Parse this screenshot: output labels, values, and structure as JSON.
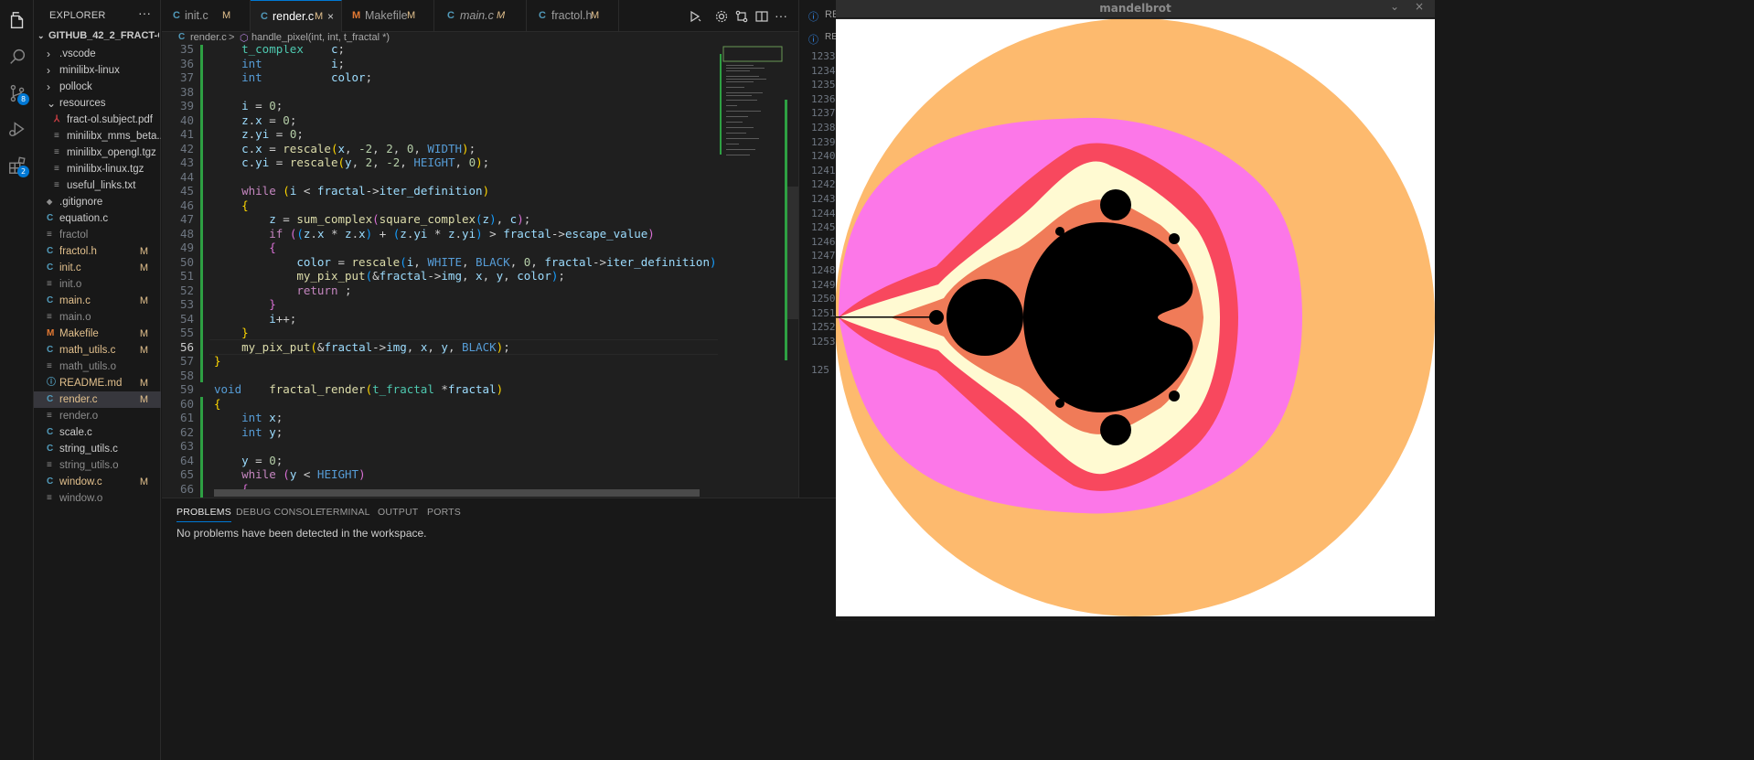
{
  "activity": {
    "scm_badge": "8",
    "ext_badge": "2"
  },
  "explorer": {
    "header": "EXPLORER",
    "more": "···",
    "root": "GITHUB_42_2_FRACT-OL",
    "items": [
      {
        "label": ".vscode",
        "type": "folder",
        "mark": ""
      },
      {
        "label": "minilibx-linux",
        "type": "folder",
        "mark": ""
      },
      {
        "label": "pollock",
        "type": "folder",
        "mark": ""
      },
      {
        "label": "resources",
        "type": "folder-open",
        "mark": ""
      },
      {
        "label": "fract-ol.subject.pdf",
        "type": "pdf",
        "mark": ""
      },
      {
        "label": "minilibx_mms_beta...",
        "type": "file",
        "mark": ""
      },
      {
        "label": "minilibx_opengl.tgz",
        "type": "file",
        "mark": ""
      },
      {
        "label": "minilibx-linux.tgz",
        "type": "file",
        "mark": ""
      },
      {
        "label": "useful_links.txt",
        "type": "file",
        "mark": ""
      },
      {
        "label": ".gitignore",
        "type": "git",
        "mark": ""
      },
      {
        "label": "equation.c",
        "type": "c",
        "mark": ""
      },
      {
        "label": "fractol",
        "type": "file",
        "mark": ""
      },
      {
        "label": "fractol.h",
        "type": "c",
        "mark": "M"
      },
      {
        "label": "init.c",
        "type": "c",
        "mark": "M"
      },
      {
        "label": "init.o",
        "type": "file",
        "mark": ""
      },
      {
        "label": "main.c",
        "type": "c",
        "mark": "M"
      },
      {
        "label": "main.o",
        "type": "file",
        "mark": ""
      },
      {
        "label": "Makefile",
        "type": "make",
        "mark": "M"
      },
      {
        "label": "math_utils.c",
        "type": "c",
        "mark": "M"
      },
      {
        "label": "math_utils.o",
        "type": "file",
        "mark": ""
      },
      {
        "label": "README.md",
        "type": "md",
        "mark": "M"
      },
      {
        "label": "render.c",
        "type": "c",
        "mark": "M"
      },
      {
        "label": "render.o",
        "type": "file",
        "mark": ""
      },
      {
        "label": "scale.c",
        "type": "c",
        "mark": ""
      },
      {
        "label": "string_utils.c",
        "type": "c",
        "mark": ""
      },
      {
        "label": "string_utils.o",
        "type": "file",
        "mark": ""
      },
      {
        "label": "window.c",
        "type": "c",
        "mark": "M"
      },
      {
        "label": "window.o",
        "type": "file",
        "mark": ""
      }
    ]
  },
  "tabs": [
    {
      "icon": "C",
      "label": "init.c",
      "mark": "M"
    },
    {
      "icon": "C",
      "label": "render.c",
      "mark": "M",
      "close": "×"
    },
    {
      "icon": "M",
      "label": "Makefile",
      "mark": "M"
    },
    {
      "icon": "C",
      "label": "main.c",
      "mark": "M"
    },
    {
      "icon": "C",
      "label": "fractol.h",
      "mark": "M"
    }
  ],
  "right_tab": {
    "icon": "ⓘ",
    "label": "RE"
  },
  "breadcrumb": {
    "file": "render.c",
    "sep": ">",
    "symbol": "handle_pixel(int, int, t_fractal *)"
  },
  "code": {
    "current_line": "56",
    "lines": [
      {
        "n": "35",
        "html": "    <span class='k-typ2'>t_complex</span>    <span class='k-var'>c</span>;"
      },
      {
        "n": "36",
        "html": "    <span class='k-type'>int</span>          <span class='k-var'>i</span>;"
      },
      {
        "n": "37",
        "html": "    <span class='k-type'>int</span>          <span class='k-var'>color</span>;"
      },
      {
        "n": "38",
        "html": ""
      },
      {
        "n": "39",
        "html": "    <span class='k-var'>i</span> = <span class='k-num'>0</span>;"
      },
      {
        "n": "40",
        "html": "    <span class='k-var'>z</span>.<span class='k-var'>x</span> = <span class='k-num'>0</span>;"
      },
      {
        "n": "41",
        "html": "    <span class='k-var'>z</span>.<span class='k-var'>yi</span> = <span class='k-num'>0</span>;"
      },
      {
        "n": "42",
        "html": "    <span class='k-var'>c</span>.<span class='k-var'>x</span> = <span class='k-fn'>rescale</span><span class='k-br'>(</span><span class='k-var'>x</span>, <span class='k-num'>-2</span>, <span class='k-num'>2</span>, <span class='k-num'>0</span>, <span class='k-mac'>WIDTH</span><span class='k-br'>)</span>;"
      },
      {
        "n": "43",
        "html": "    <span class='k-var'>c</span>.<span class='k-var'>yi</span> = <span class='k-fn'>rescale</span><span class='k-br'>(</span><span class='k-var'>y</span>, <span class='k-num'>2</span>, <span class='k-num'>-2</span>, <span class='k-mac'>HEIGHT</span>, <span class='k-num'>0</span><span class='k-br'>)</span>;"
      },
      {
        "n": "44",
        "html": ""
      },
      {
        "n": "45",
        "html": "    <span class='k-ctl'>while</span> <span class='k-br'>(</span><span class='k-var'>i</span> &lt; <span class='k-var'>fractal</span>-&gt;<span class='k-var'>iter_definition</span><span class='k-br'>)</span>"
      },
      {
        "n": "46",
        "html": "    <span class='k-br'>{</span>"
      },
      {
        "n": "47",
        "html": "        <span class='k-var'>z</span> = <span class='k-fn'>sum_complex</span><span class='k-br2'>(</span><span class='k-fn'>square_complex</span><span class='k-br3'>(</span><span class='k-var'>z</span><span class='k-br3'>)</span>, <span class='k-var'>c</span><span class='k-br2'>)</span>;"
      },
      {
        "n": "48",
        "html": "        <span class='k-ctl'>if</span> <span class='k-br2'>(</span><span class='k-br3'>(</span><span class='k-var'>z</span>.<span class='k-var'>x</span> * <span class='k-var'>z</span>.<span class='k-var'>x</span><span class='k-br3'>)</span> + <span class='k-br3'>(</span><span class='k-var'>z</span>.<span class='k-var'>yi</span> * <span class='k-var'>z</span>.<span class='k-var'>yi</span><span class='k-br3'>)</span> &gt; <span class='k-var'>fractal</span>-&gt;<span class='k-var'>escape_value</span><span class='k-br2'>)</span>"
      },
      {
        "n": "49",
        "html": "        <span class='k-br2'>{</span>"
      },
      {
        "n": "50",
        "html": "            <span class='k-var'>color</span> = <span class='k-fn'>rescale</span><span class='k-br3'>(</span><span class='k-var'>i</span>, <span class='k-mac'>WHITE</span>, <span class='k-mac'>BLACK</span>, <span class='k-num'>0</span>, <span class='k-var'>fractal</span>-&gt;<span class='k-var'>iter_definition</span><span class='k-br3'>)</span>;"
      },
      {
        "n": "51",
        "html": "            <span class='k-fn'>my_pix_put</span><span class='k-br3'>(</span>&amp;<span class='k-var'>fractal</span>-&gt;<span class='k-var'>img</span>, <span class='k-var'>x</span>, <span class='k-var'>y</span>, <span class='k-var'>color</span><span class='k-br3'>)</span>;"
      },
      {
        "n": "52",
        "html": "            <span class='k-ctl'>return</span> ;"
      },
      {
        "n": "53",
        "html": "        <span class='k-br2'>}</span>"
      },
      {
        "n": "54",
        "html": "        <span class='k-var'>i</span>++;"
      },
      {
        "n": "55",
        "html": "    <span class='k-br'>}</span>"
      },
      {
        "n": "56",
        "html": "    <span class='k-fn'>my_pix_put</span><span class='k-br'>(</span>&amp;<span class='k-var'>fractal</span>-&gt;<span class='k-var'>img</span>, <span class='k-var'>x</span>, <span class='k-var'>y</span>, <span class='k-mac'>BLACK</span><span class='k-br'>)</span>;"
      },
      {
        "n": "57",
        "html": "<span class='k-br'>}</span>"
      },
      {
        "n": "58",
        "html": ""
      },
      {
        "n": "59",
        "html": "<span class='k-type'>void</span>    <span class='k-fn'>fractal_render</span><span class='k-br'>(</span><span class='k-typ2'>t_fractal</span> *<span class='k-var'>fractal</span><span class='k-br'>)</span>"
      },
      {
        "n": "60",
        "html": "<span class='k-br'>{</span>"
      },
      {
        "n": "61",
        "html": "    <span class='k-type'>int</span> <span class='k-var'>x</span>;"
      },
      {
        "n": "62",
        "html": "    <span class='k-type'>int</span> <span class='k-var'>y</span>;"
      },
      {
        "n": "63",
        "html": ""
      },
      {
        "n": "64",
        "html": "    <span class='k-var'>y</span> = <span class='k-num'>0</span>;"
      },
      {
        "n": "65",
        "html": "    <span class='k-ctl'>while</span> <span class='k-br2'>(</span><span class='k-var'>y</span> &lt; <span class='k-mac'>HEIGHT</span><span class='k-br2'>)</span>"
      },
      {
        "n": "66",
        "html": "    <span class='k-br2'>{</span>"
      }
    ]
  },
  "right_strip_lines": [
    "1233",
    "1234",
    "1235",
    "1236",
    "1237",
    "1238",
    "1239",
    "1240",
    "1241",
    "1242",
    "1243",
    "1244",
    "1245",
    "1246",
    "1247",
    "1248",
    "1249",
    "1250",
    "1251",
    "1252",
    "1253",
    "",
    "125"
  ],
  "panel": {
    "tabs": [
      "PROBLEMS",
      "DEBUG CONSOLE",
      "TERMINAL",
      "OUTPUT",
      "PORTS"
    ],
    "message": "No problems have been detected in the workspace."
  },
  "mandelbrot": {
    "title": "mandelbrot",
    "controls": [
      "⌄",
      "×"
    ],
    "colors": {
      "background": "#ffffff",
      "outer": "#fdba6e",
      "band2": "#fc77e8",
      "band3": "#f8485e",
      "band4": "#fffad2",
      "band5": "#f07b58",
      "set": "#000000"
    }
  }
}
